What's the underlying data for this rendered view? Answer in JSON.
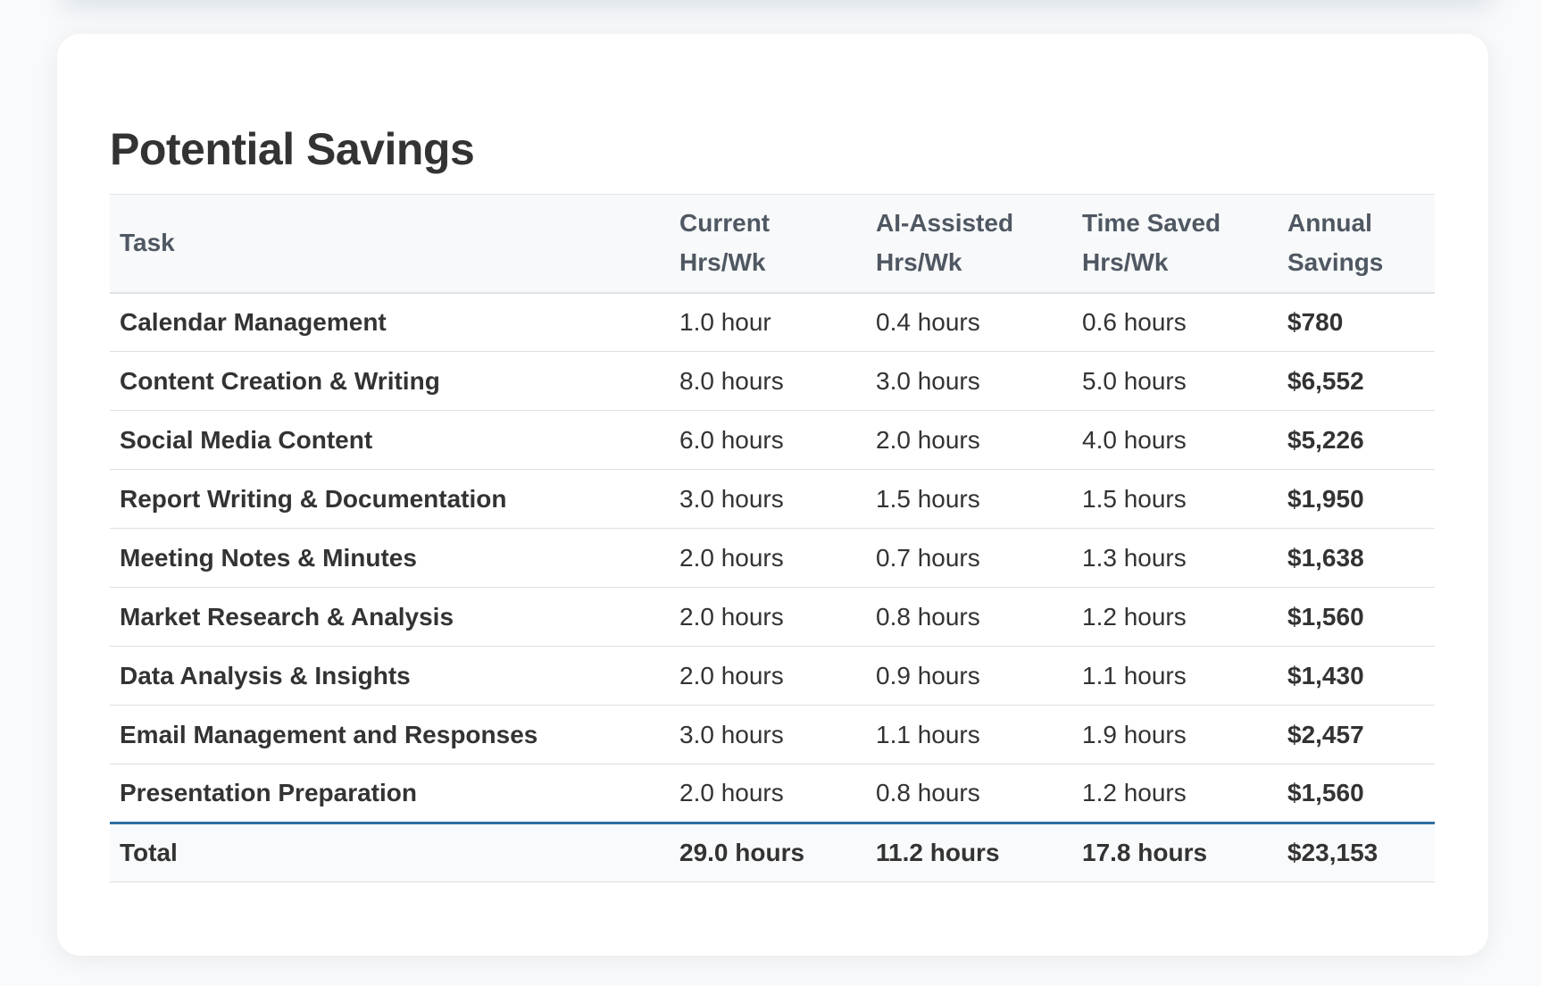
{
  "title": "Potential Savings",
  "table": {
    "headers": {
      "task": "Task",
      "current": [
        "Current",
        "Hrs/Wk"
      ],
      "ai": [
        "AI-Assisted",
        "Hrs/Wk"
      ],
      "saved": [
        "Time Saved",
        "Hrs/Wk"
      ],
      "annual": [
        "Annual",
        "Savings"
      ]
    },
    "rows": [
      {
        "task": "Calendar Management",
        "current": "1.0 hour",
        "ai": "0.4 hours",
        "saved": "0.6 hours",
        "annual": "$780"
      },
      {
        "task": "Content Creation & Writing",
        "current": "8.0 hours",
        "ai": "3.0 hours",
        "saved": "5.0 hours",
        "annual": "$6,552"
      },
      {
        "task": "Social Media Content",
        "current": "6.0 hours",
        "ai": "2.0 hours",
        "saved": "4.0 hours",
        "annual": "$5,226"
      },
      {
        "task": "Report Writing & Documentation",
        "current": "3.0 hours",
        "ai": "1.5 hours",
        "saved": "1.5 hours",
        "annual": "$1,950"
      },
      {
        "task": "Meeting Notes & Minutes",
        "current": "2.0 hours",
        "ai": "0.7 hours",
        "saved": "1.3 hours",
        "annual": "$1,638"
      },
      {
        "task": "Market Research & Analysis",
        "current": "2.0 hours",
        "ai": "0.8 hours",
        "saved": "1.2 hours",
        "annual": "$1,560"
      },
      {
        "task": "Data Analysis & Insights",
        "current": "2.0 hours",
        "ai": "0.9 hours",
        "saved": "1.1 hours",
        "annual": "$1,430"
      },
      {
        "task": "Email Management and Responses",
        "current": "3.0 hours",
        "ai": "1.1 hours",
        "saved": "1.9 hours",
        "annual": "$2,457"
      },
      {
        "task": "Presentation Preparation",
        "current": "2.0 hours",
        "ai": "0.8 hours",
        "saved": "1.2 hours",
        "annual": "$1,560"
      }
    ],
    "total": {
      "task": "Total",
      "current": "29.0 hours",
      "ai": "11.2 hours",
      "saved": "17.8 hours",
      "annual": "$23,153"
    }
  },
  "colors": {
    "accent_border": "#2f6fa3",
    "header_bg": "#f8f9fa",
    "text": "#333333"
  }
}
